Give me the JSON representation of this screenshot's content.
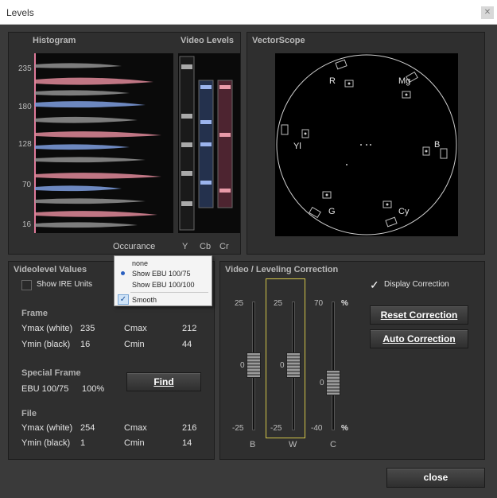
{
  "window": {
    "title": "Levels"
  },
  "histogram": {
    "title": "Histogram",
    "video_levels_title": "Video Levels",
    "y_ticks": [
      "235",
      "180",
      "128",
      "70",
      "16"
    ],
    "occurance_label": "Occurance",
    "channels": [
      "Y",
      "Cb",
      "Cr"
    ],
    "colors": {
      "y": "#9a9a9a",
      "cb": "#7f9fe0",
      "cr": "#e08a9a"
    }
  },
  "vectorscope": {
    "title": "VectorScope",
    "labels": [
      "R",
      "Mg",
      "Yl",
      "B",
      "G",
      "Cy"
    ]
  },
  "occurance_menu": {
    "items": [
      {
        "label": "none",
        "checked": false,
        "bullet": false
      },
      {
        "label": "Show EBU 100/75",
        "checked": false,
        "bullet": true
      },
      {
        "label": "Show EBU 100/100",
        "checked": false,
        "bullet": false
      },
      {
        "label": "Smooth",
        "checked": true,
        "bullet": false
      }
    ]
  },
  "videolevel": {
    "title": "Videolevel Values",
    "show_ire_label": "Show IRE Units",
    "frame_title": "Frame",
    "frame": {
      "ymax_label": "Ymax (white)",
      "ymax": "235",
      "ymin_label": "Ymin (black)",
      "ymin": "16",
      "cmax_label": "Cmax",
      "cmax": "212",
      "cmin_label": "Cmin",
      "cmin": "44"
    },
    "special_title": "Special Frame",
    "special_name": "EBU 100/75",
    "special_pct": "100%",
    "find_label": "Find",
    "file_title": "File",
    "file": {
      "ymax_label": "Ymax (white)",
      "ymax": "254",
      "ymin_label": "Ymin (black)",
      "ymin": "1",
      "cmax_label": "Cmax",
      "cmax": "216",
      "cmin_label": "Cmin",
      "cmin": "14"
    }
  },
  "correction": {
    "title": "Video / Leveling Correction",
    "display_label": "Display Correction",
    "reset_label": "Reset Correction",
    "auto_label": "Auto Correction",
    "sliders": [
      {
        "name": "B",
        "top": "25",
        "mid": "0",
        "bottom": "-25",
        "level": 0.5
      },
      {
        "name": "W",
        "top": "25",
        "mid": "0",
        "bottom": "-25",
        "level": 0.5
      },
      {
        "name": "C",
        "top": "70",
        "mid": "0",
        "bottom": "-40",
        "level": 0.36
      }
    ],
    "pct_top": "%",
    "pct_bottom": "%"
  },
  "close_label": "close"
}
